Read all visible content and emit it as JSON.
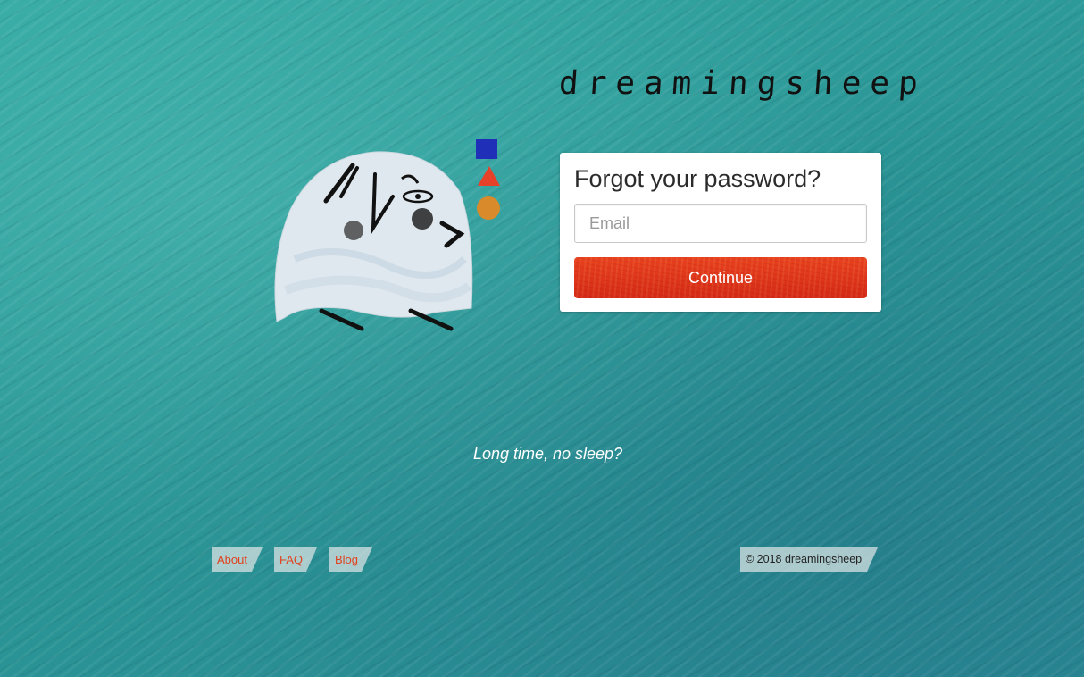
{
  "brand": {
    "logo_text": "dreamingsheep"
  },
  "mascot": {
    "icon": "sheep-mascot-icon",
    "shapes": [
      "blue-square-icon",
      "red-triangle-icon",
      "orange-circle-icon"
    ]
  },
  "form": {
    "title": "Forgot your password?",
    "email_placeholder": "Email",
    "email_value": "",
    "continue_label": "Continue"
  },
  "tagline": "Long time, no sleep?",
  "footer": {
    "links": [
      {
        "label": "About"
      },
      {
        "label": "FAQ"
      },
      {
        "label": "Blog"
      }
    ],
    "copyright": "© 2018 dreamingsheep"
  },
  "colors": {
    "background": "#2e9d9a",
    "button": "#e0321c",
    "link": "#e0421f"
  }
}
